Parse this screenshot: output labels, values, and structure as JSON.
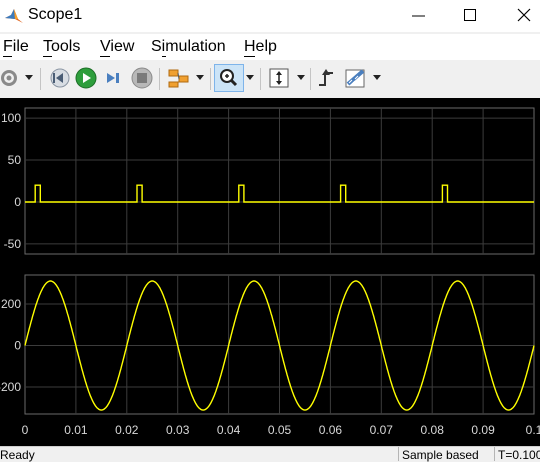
{
  "window": {
    "title": "Scope1",
    "controls": [
      "minimize",
      "maximize",
      "close"
    ]
  },
  "menu": {
    "items": [
      {
        "label": "File",
        "mnemonic": "F"
      },
      {
        "label": "Tools",
        "mnemonic": "T"
      },
      {
        "label": "View",
        "mnemonic": "V"
      },
      {
        "label": "Simulation",
        "mnemonic": "i"
      },
      {
        "label": "Help",
        "mnemonic": "H"
      }
    ]
  },
  "toolbar": {
    "buttons": [
      {
        "icon": "gear-icon",
        "dropdown": true
      },
      {
        "icon": "step-back-icon",
        "dropdown": false
      },
      {
        "icon": "run-icon",
        "dropdown": false
      },
      {
        "icon": "step-forward-icon",
        "dropdown": false
      },
      {
        "icon": "stop-icon",
        "dropdown": false
      },
      {
        "icon": "signal-selector-icon",
        "dropdown": true
      },
      {
        "icon": "zoom-icon",
        "dropdown": true,
        "active": true
      },
      {
        "icon": "autoscale-icon",
        "dropdown": true
      },
      {
        "icon": "trigger-icon",
        "dropdown": false
      },
      {
        "icon": "measurements-icon",
        "dropdown": true
      }
    ]
  },
  "colors": {
    "plot_background": "#000000",
    "grid": "#3c3c3c",
    "signal": "#ffff00",
    "tick_label": "#d8d8d8"
  },
  "chart_data": [
    {
      "type": "line",
      "title": "",
      "xlabel": "",
      "ylabel": "",
      "xlim": [
        0,
        0.1
      ],
      "ylim": [
        -62,
        112
      ],
      "yticks": [
        -50,
        0,
        50,
        100
      ],
      "grid": true,
      "series": [
        {
          "color": "#ffff00",
          "description": "pulse train, period 0.02, width 0.001",
          "x": [
            0,
            0.002,
            0.002,
            0.003,
            0.003,
            0.022,
            0.022,
            0.023,
            0.023,
            0.042,
            0.042,
            0.043,
            0.043,
            0.062,
            0.062,
            0.063,
            0.063,
            0.082,
            0.082,
            0.083,
            0.083,
            0.1
          ],
          "y": [
            0,
            0,
            20,
            20,
            0,
            0,
            20,
            20,
            0,
            0,
            20,
            20,
            0,
            0,
            20,
            20,
            0,
            0,
            20,
            20,
            0,
            0
          ]
        }
      ]
    },
    {
      "type": "line",
      "title": "",
      "xlabel": "",
      "ylabel": "",
      "xlim": [
        0,
        0.1
      ],
      "ylim": [
        -330,
        340
      ],
      "yticks": [
        -200,
        0,
        200
      ],
      "xticks": [
        0,
        0.01,
        0.02,
        0.03,
        0.04,
        0.05,
        0.06,
        0.07,
        0.08,
        0.09
      ],
      "xtick_labels": [
        "0",
        "0.01",
        "0.02",
        "0.03",
        "0.04",
        "0.05",
        "0.06",
        "0.07",
        "0.08",
        "0.09",
        "0.1"
      ],
      "ytick_labels": [
        "-200",
        "0",
        "200"
      ],
      "grid": true,
      "series": [
        {
          "color": "#ffff00",
          "description": "sine wave, 50 Hz",
          "amplitude": 311,
          "frequency_hz": 50
        }
      ]
    }
  ],
  "status": {
    "left": "Ready",
    "mode": "Sample based",
    "time": "T=0.100"
  }
}
